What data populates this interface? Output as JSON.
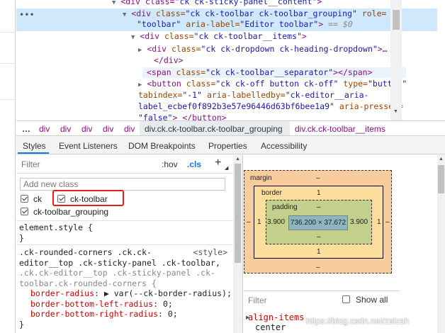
{
  "tree": {
    "line0": {
      "open": "<div class=",
      "cls": "\"ck ck-sticky-panel__content\"",
      "close": ">"
    },
    "line1": {
      "open": "<div",
      "attr1": "class=",
      "val1": "\"ck ck-toolbar ck-toolbar_grouping\"",
      "attr2": "role=",
      "val2": "\"toolbar\"",
      "attr3": "aria-label=",
      "val3": "\"Editor toolbar\"",
      "close": ">",
      "eq": "== $0"
    },
    "line2": {
      "open": "<div",
      "attr": "class=",
      "val": "\"ck ck-toolbar__items\"",
      "close": ">"
    },
    "line3": {
      "open": "<div",
      "attr": "class=",
      "val": "\"ck ck-dropdown ck-heading-dropdown\"",
      "close": ">…"
    },
    "line4": {
      "text": "</div>"
    },
    "line5": {
      "open": "<span",
      "attr": "class=",
      "val": "\"ck ck-toolbar__separator\"",
      "close": "></span>"
    },
    "line6": {
      "open": "<button",
      "attr1": "class=",
      "val1": "\"ck ck-off button ck-off\"",
      "attr2": "type=",
      "val2": "\"button\""
    },
    "line7": {
      "attr1": "tabindex=",
      "val1": "\"-1\"",
      "attr2": "aria-labelledby=",
      "val2": "\"ck-editor__aria-"
    },
    "line8": {
      "val1": "label_ecbef0f892b3e57e96446d63bf6bee1a9\"",
      "attr2": "aria-pressed="
    },
    "line9": {
      "val": "\"false\"",
      "close": "> </button>"
    }
  },
  "breadcrumb": {
    "dots": "…",
    "items": [
      "div",
      "div",
      "div",
      "div",
      "div"
    ],
    "active": "div.ck.ck-toolbar.ck-toolbar_grouping",
    "next": "div.ck.ck-toolbar__items"
  },
  "tabs": [
    "Styles",
    "Event Listeners",
    "DOM Breakpoints",
    "Properties",
    "Accessibility"
  ],
  "styles": {
    "filter_placeholder": "Filter",
    "hov": ":hov",
    "cls": ".cls",
    "plus": "+",
    "new_class_placeholder": "Add new class",
    "classes": [
      "ck",
      "ck-toolbar",
      "ck-toolbar_grouping"
    ],
    "element_style": "element.style {",
    "close_brace": "}",
    "rule2": {
      "selector_l1": ".ck-rounded-corners .ck.ck-",
      "source": "<style>",
      "selector_l2": "editor__top .ck-sticky-panel .ck-toolbar,",
      "selector_l3": ".ck.ck-editor__top .ck-sticky-panel .ck-",
      "selector_l4": "toolbar.ck-rounded-corners {",
      "props": [
        {
          "name": "border-radius",
          "value": "▶ var(--ck-border-radius);"
        },
        {
          "name": "border-bottom-left-radius",
          "value": "0;"
        },
        {
          "name": "border-bottom-right-radius",
          "value": "0;"
        }
      ],
      "close": "}"
    }
  },
  "boxmodel": {
    "margin_label": "margin",
    "margin_top": "–",
    "margin_bottom": "–",
    "margin_left": "–",
    "margin_right": "–",
    "border_label": "border",
    "border_top": "1",
    "border_bottom": "1",
    "border_left": "1",
    "border_right": "1",
    "padding_label": "padding",
    "padding_top": "–",
    "padding_bottom": "–",
    "padding_left": "3.900",
    "padding_right": "3.900",
    "content": "736.200 × 37.672"
  },
  "computed": {
    "filter_placeholder": "Filter",
    "show_all": "Show all",
    "prop": "align-items",
    "value": "center"
  },
  "watermark": "https://blog.csdn.net/zstzah"
}
